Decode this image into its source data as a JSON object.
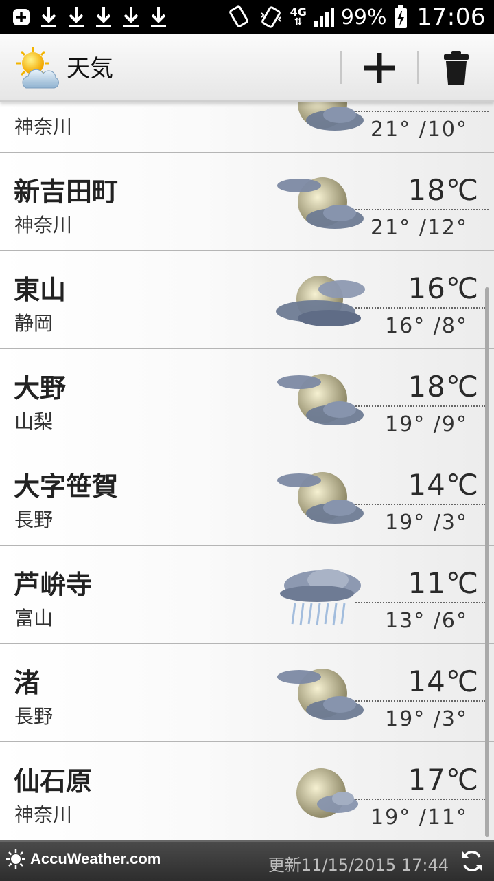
{
  "status_bar": {
    "battery": "99%",
    "network": "4G",
    "time": "17:06"
  },
  "action_bar": {
    "title": "天気",
    "add_icon": "plus-icon",
    "delete_icon": "trash-icon"
  },
  "locations": [
    {
      "city": "",
      "prefecture": "神奈川",
      "temperature": "",
      "high_low": "21°  /10°",
      "icon": "moon-cloud-icon"
    },
    {
      "city": "新吉田町",
      "prefecture": "神奈川",
      "temperature": "18℃",
      "high_low": "21°  /12°",
      "icon": "moon-clouds-icon"
    },
    {
      "city": "東山",
      "prefecture": "静岡",
      "temperature": "16℃",
      "high_low": "16°  /8°",
      "icon": "mostly-cloudy-night-icon"
    },
    {
      "city": "大野",
      "prefecture": "山梨",
      "temperature": "18℃",
      "high_low": "19°  /9°",
      "icon": "moon-clouds-icon"
    },
    {
      "city": "大字笹賀",
      "prefecture": "長野",
      "temperature": "14℃",
      "high_low": "19°  /3°",
      "icon": "moon-clouds-icon"
    },
    {
      "city": "芦峅寺",
      "prefecture": "富山",
      "temperature": "11℃",
      "high_low": "13°  /6°",
      "icon": "rain-icon"
    },
    {
      "city": "渚",
      "prefecture": "長野",
      "temperature": "14℃",
      "high_low": "19°  /3°",
      "icon": "moon-clouds-icon"
    },
    {
      "city": "仙石原",
      "prefecture": "神奈川",
      "temperature": "17℃",
      "high_low": "19°  /11°",
      "icon": "moon-cloud-icon"
    }
  ],
  "footer": {
    "brand": "AccuWeather.com",
    "updated": "更新11/15/2015 17:44"
  }
}
